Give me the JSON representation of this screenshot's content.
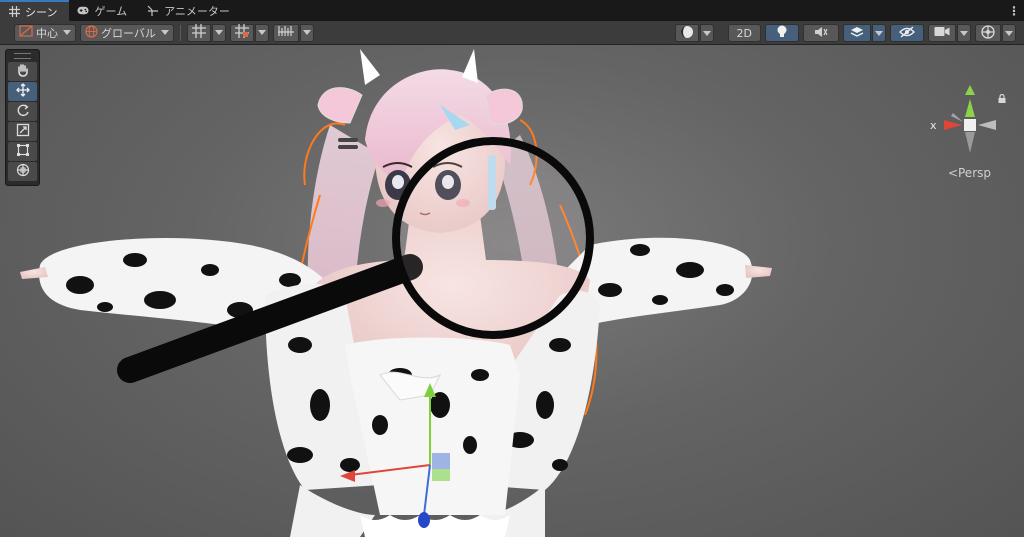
{
  "tabs": [
    {
      "label": "シーン",
      "icon": "grid-icon",
      "active": true
    },
    {
      "label": "ゲーム",
      "icon": "gamepad-icon",
      "active": false
    },
    {
      "label": "アニメーター",
      "icon": "animator-icon",
      "active": false
    }
  ],
  "toolbar": {
    "pivot_label": "中心",
    "space_label": "グローバル",
    "mode_2d_label": "2D"
  },
  "gizmo": {
    "x_axis_label": "x",
    "projection_label": "Persp"
  },
  "colors": {
    "accent_blue": "#46607c",
    "axis_x": "#e0453a",
    "axis_y": "#8bd449",
    "axis_z": "#3a6fd8",
    "selection_outline": "#ff7a1a"
  }
}
